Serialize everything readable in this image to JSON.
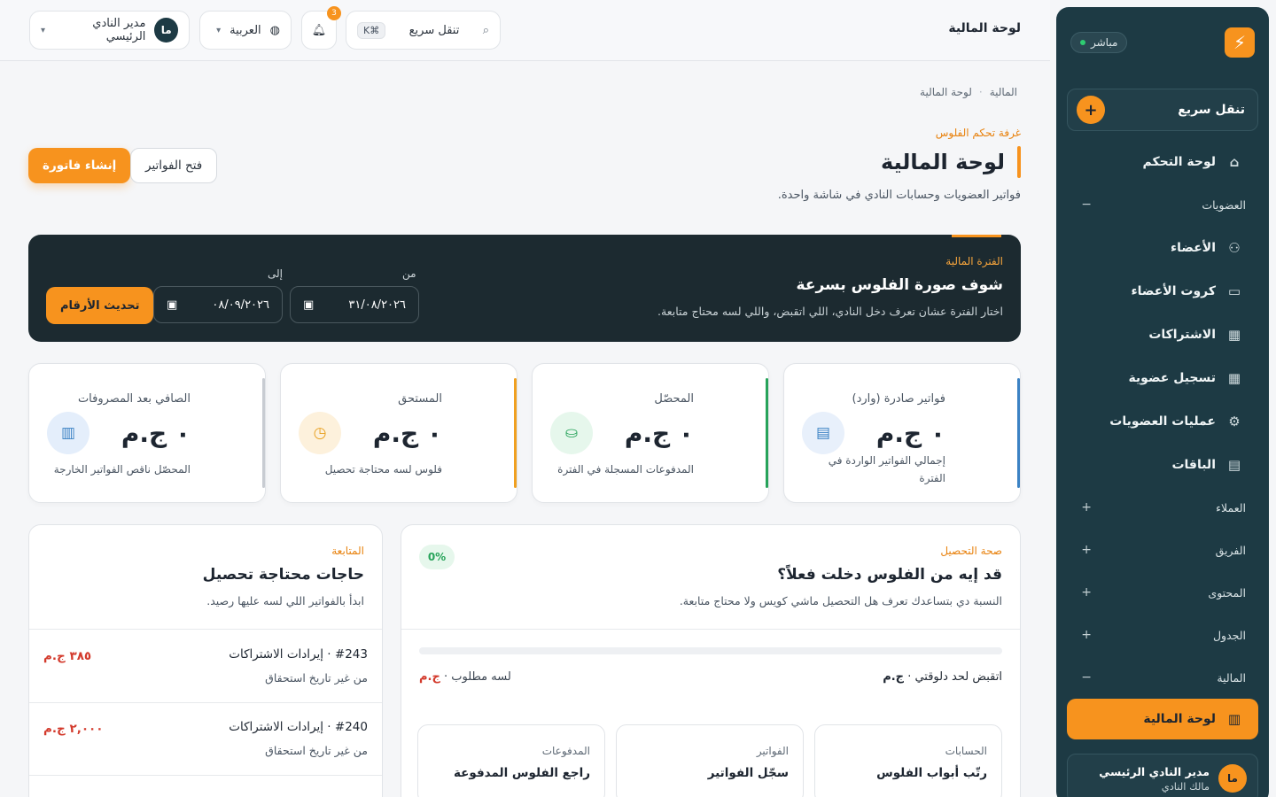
{
  "sidebar": {
    "logo_icon": "brand-logo-icon",
    "live_label": "مباشر",
    "quick_nav_label": "تنقل سريع",
    "items_top": [
      {
        "label": "لوحة التحكم",
        "icon": "home-icon",
        "glyph": "⌂"
      }
    ],
    "section_memberships": {
      "label": "العضويات",
      "toggle": "−"
    },
    "membership_items": [
      {
        "label": "الأعضاء",
        "icon": "users-icon",
        "glyph": "👥"
      },
      {
        "label": "كروت الأعضاء",
        "icon": "card-icon",
        "glyph": "▭"
      },
      {
        "label": "الاشتراكات",
        "icon": "clipboard-icon",
        "glyph": "📋"
      },
      {
        "label": "تسجيل عضوية",
        "icon": "clipboard-icon",
        "glyph": "📋"
      },
      {
        "label": "عمليات العضويات",
        "icon": "user-ops-icon",
        "glyph": "⚙"
      },
      {
        "label": "الباقات",
        "icon": "package-icon",
        "glyph": "▤"
      }
    ],
    "sections_collapsed": [
      {
        "label": "العملاء",
        "toggle": "+"
      },
      {
        "label": "الفريق",
        "toggle": "+"
      },
      {
        "label": "المحتوى",
        "toggle": "+"
      },
      {
        "label": "الجدول",
        "toggle": "+"
      }
    ],
    "section_finance": {
      "label": "المالية",
      "toggle": "−"
    },
    "active_item": {
      "label": "لوحة المالية",
      "icon": "bar-chart-icon",
      "glyph": "📊"
    },
    "user": {
      "initials": "ما",
      "name": "مدير النادي الرئيسي",
      "role": "مالك النادي"
    }
  },
  "topbar": {
    "title": "لوحة المالية",
    "search_placeholder": "تنقل سريع",
    "search_shortcut": "⌘K",
    "notifications_count": "3",
    "language": "العربية",
    "user_initials": "ما",
    "user_name": "مدير النادي الرئيسي"
  },
  "breadcrumb": {
    "parent": "المالية",
    "separator": "·",
    "current": "لوحة المالية"
  },
  "page": {
    "eyebrow": "غرفة تحكم الفلوس",
    "title": "لوحة المالية",
    "subtitle": "فواتير العضويات وحسابات النادي في شاشة واحدة.",
    "create_invoice": "إنشاء فاتورة",
    "open_invoices": "فتح الفواتير"
  },
  "period": {
    "eyebrow": "الفترة المالية",
    "title": "شوف صورة الفلوس بسرعة",
    "subtitle": "اختار الفترة عشان تعرف دخل النادي، اللي اتقبض، واللي لسه محتاج متابعة.",
    "from_label": "من",
    "from_value": "٣١/٠٨/٢٠٢٦",
    "to_label": "إلى",
    "to_value": "٠٨/٠٩/٢٠٢٦",
    "update_button": "تحديث الأرقام"
  },
  "kpis": [
    {
      "label": "فواتير صادرة (وارد)",
      "value": "٠ ج.م",
      "desc": "إجمالي الفواتير الواردة في الفترة",
      "icon": "invoice-icon",
      "glyph": "🗎",
      "color": "#3b82c4",
      "bg": "#e8f0fb"
    },
    {
      "label": "المحصّل",
      "value": "٠ ج.م",
      "desc": "المدفوعات المسجلة في الفترة",
      "icon": "cash-icon",
      "glyph": "💵",
      "color": "#27a35a",
      "bg": "#e6f7ec"
    },
    {
      "label": "المستحق",
      "value": "٠ ج.م",
      "desc": "فلوس لسه محتاجة تحصيل",
      "icon": "clock-icon",
      "glyph": "◷",
      "color": "#f0a020",
      "bg": "#fdf1dc"
    },
    {
      "label": "الصافي بعد المصروفات",
      "value": "٠ ج.م",
      "desc": "المحصّل ناقص الفواتير الخارجة",
      "icon": "chart-icon",
      "glyph": "📊",
      "color": "#3b82c4",
      "bg": "#e4eefb"
    }
  ],
  "collection": {
    "eyebrow": "صحة التحصيل",
    "title": "قد إيه من الفلوس دخلت فعلاً؟",
    "subtitle": "النسبة دي بتساعدك تعرف هل التحصيل ماشي كويس ولا محتاج متابعة.",
    "percent_label": "0%",
    "progress": 0,
    "collected_label": "اتقبض لحد دلوقتي ·",
    "collected_value": "ج.م",
    "required_label": "لسه مطلوب ·",
    "required_value": "ج.م",
    "tiles": [
      {
        "kicker": "الحسابات",
        "title": "رتّب أبواب الفلوس"
      },
      {
        "kicker": "الفواتير",
        "title": "سجّل الفواتير"
      },
      {
        "kicker": "المدفوعات",
        "title": "راجع الفلوس المدفوعة"
      }
    ]
  },
  "followup": {
    "eyebrow": "المتابعة",
    "title": "حاجات محتاجة تحصيل",
    "subtitle": "ابدأ بالفواتير اللي لسه عليها رصيد.",
    "rows": [
      {
        "title": "#243 · إيرادات الاشتراكات",
        "due": "من غير تاريخ استحقاق",
        "amount": "٣٨٥ ج.م"
      },
      {
        "title": "#240 · إيرادات الاشتراكات",
        "due": "من غير تاريخ استحقاق",
        "amount": "٢,٠٠٠ ج.م"
      }
    ]
  }
}
